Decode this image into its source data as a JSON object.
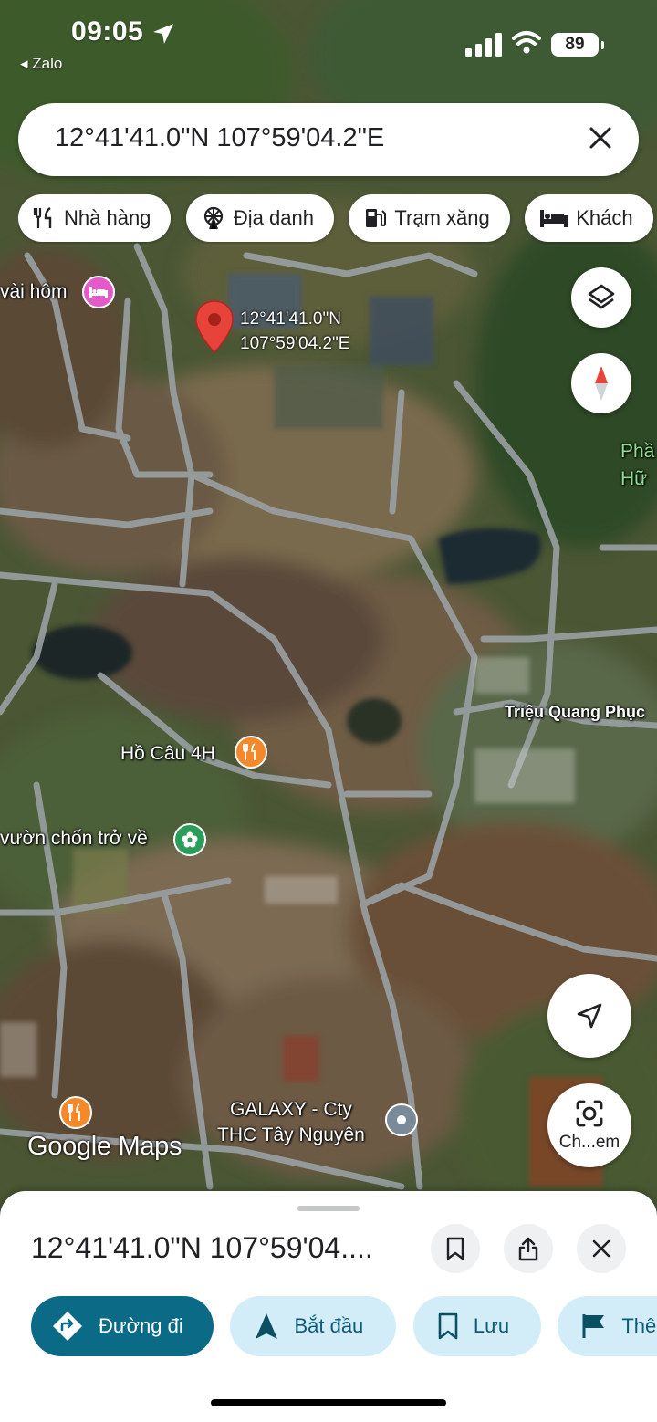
{
  "status_bar": {
    "time": "09:05",
    "back_app": "◂ Zalo",
    "battery": "89"
  },
  "search": {
    "query": "12°41'41.0\"N 107°59'04.2\"E"
  },
  "chips": [
    {
      "label": "Nhà hàng",
      "icon": "fork-knife-icon"
    },
    {
      "label": "Địa danh",
      "icon": "ferris-wheel-icon"
    },
    {
      "label": "Trạm xăng",
      "icon": "gas-pump-icon"
    },
    {
      "label": "Khách",
      "icon": "bed-icon"
    }
  ],
  "map": {
    "pin": {
      "line1": "12°41'41.0\"N",
      "line2": "107°59'04.2\"E"
    },
    "labels": {
      "hotel": "vài hôm",
      "restaurant1": "Hồ Câu 4H",
      "garden": "vườn chốn trở về",
      "street": "Triệu Quang Phục",
      "company_line1": "GALAXY - Cty",
      "company_line2": "THC Tây Nguyên",
      "edge_line1": "Phầ",
      "edge_line2": "Hữ"
    },
    "attribution": "Google Maps",
    "lens_label": "Ch...em"
  },
  "sheet": {
    "title": "12°41'41.0\"N 107°59'04....",
    "actions": [
      {
        "label": "Đường đi",
        "icon": "directions-icon"
      },
      {
        "label": "Bắt đầu",
        "icon": "navigation-arrow-icon"
      },
      {
        "label": "Lưu",
        "icon": "bookmark-icon"
      },
      {
        "label": "Thêm",
        "icon": "flag-icon"
      }
    ]
  },
  "colors": {
    "primary": "#0b6b86",
    "tonal": "#d2edf8",
    "pin": "#e8433b",
    "poi_orange": "#f3892b",
    "poi_pink": "#e35ac8",
    "poi_green": "#2a9d5a",
    "poi_gray": "#7a8a99"
  }
}
